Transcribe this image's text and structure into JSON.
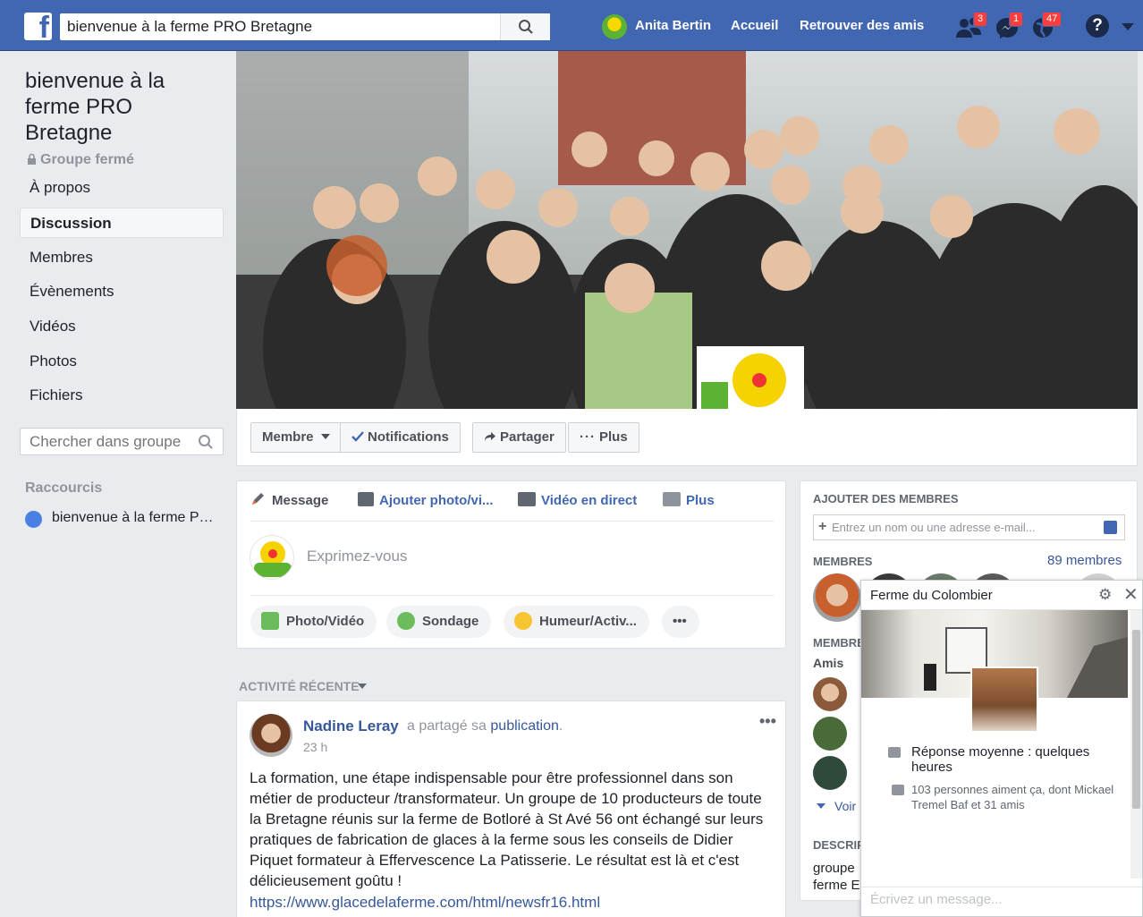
{
  "topbar": {
    "search_value": "bienvenue à la ferme PRO Bretagne",
    "user_name": "Anita Bertin",
    "home_label": "Accueil",
    "find_friends_label": "Retrouver des amis",
    "badge_friends": "3",
    "badge_messages": "1",
    "badge_notifications": "47",
    "help_icon": "?"
  },
  "sidebar": {
    "group_title": "bienvenue à la ferme PRO Bretagne",
    "privacy": "Groupe fermé",
    "items": [
      {
        "label": "À propos"
      },
      {
        "label": "Discussion"
      },
      {
        "label": "Membres"
      },
      {
        "label": "Évènements"
      },
      {
        "label": "Vidéos"
      },
      {
        "label": "Photos"
      },
      {
        "label": "Fichiers"
      }
    ],
    "search_placeholder": "Chercher dans groupe",
    "shortcuts_title": "Raccourcis",
    "shortcut_label": "bienvenue à la ferme PRO Bretagne"
  },
  "cover_actions": {
    "member": "Membre",
    "notifications": "Notifications",
    "share": "Partager",
    "more": "Plus"
  },
  "composer": {
    "tab_message": "Message",
    "tab_photo": "Ajouter photo/vi...",
    "tab_live": "Vidéo en direct",
    "tab_more": "Plus",
    "placeholder": "Exprimez-vous",
    "pill_photo": "Photo/Vidéo",
    "pill_poll": "Sondage",
    "pill_mood": "Humeur/Activ...",
    "pill_more": "•••"
  },
  "recent": {
    "title": "ACTIVITÉ RÉCENTE"
  },
  "post": {
    "author": "Nadine Leray",
    "action_prefix": "a partagé sa",
    "action_link": "publication",
    "action_suffix": ".",
    "time": "23 h",
    "menu": "•••",
    "text": "La formation, une étape indispensable pour être professionnel dans son métier de producteur /transformateur. Un groupe de 10 producteurs de toute la Bretagne réunis sur la ferme de Botloré à St Avé 56 ont échangé sur leurs pratiques de fabrication de glaces à la ferme sous les conseils de Didier Piquet formateur à Effervescence La Patisserie. Le résultat est là et c'est délicieusement goûtu !",
    "link": "https://www.glacedelaferme.com/html/newsfr16.html"
  },
  "right": {
    "add_title": "AJOUTER DES MEMBRES",
    "add_placeholder": "Entrez un nom ou une adresse e-mail...",
    "members_title": "MEMBRES",
    "members_count": "89 membres",
    "members_sub": "MEMBRE",
    "friends_sub": "Amis",
    "see_all": "Voir",
    "desc_title": "DESCRIP",
    "desc_text_1": "groupe",
    "desc_text_2": "ferme E"
  },
  "chat": {
    "title": "Ferme du Colombier",
    "response": "Réponse moyenne : quelques heures",
    "likes": "103 personnes aiment ça, dont Mickael Tremel Baf et 31 amis",
    "input_placeholder": "Écrivez un message..."
  }
}
